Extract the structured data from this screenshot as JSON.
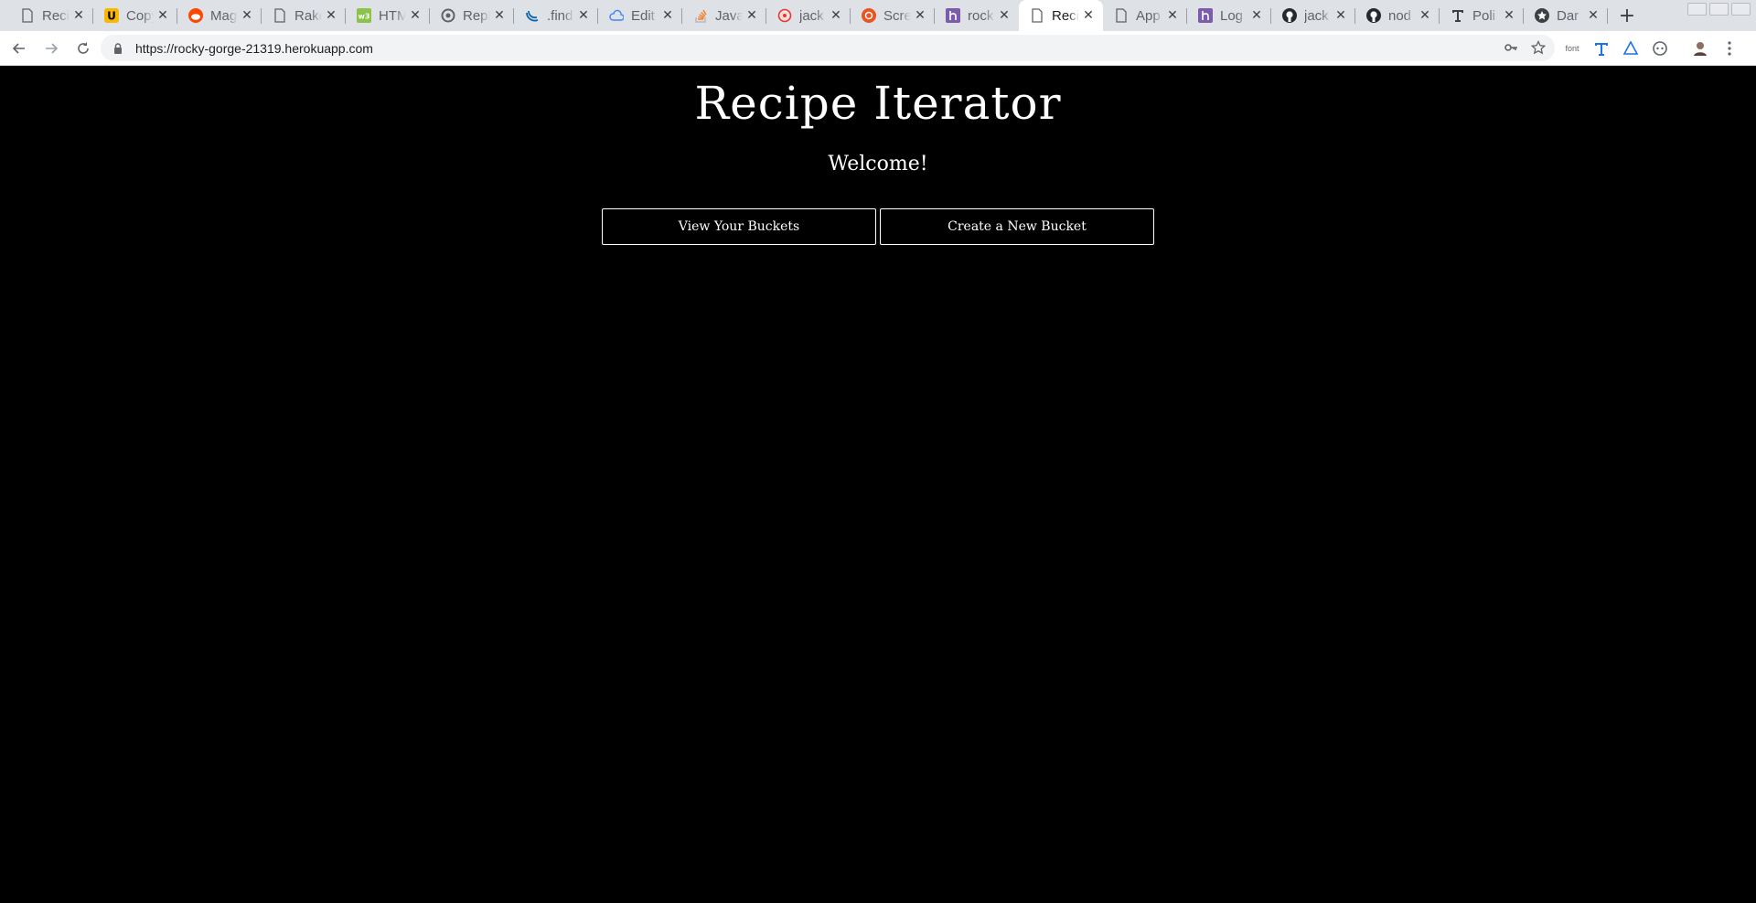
{
  "browser": {
    "tabs": [
      {
        "title": "Recipe Iterator",
        "icon": "page-icon"
      },
      {
        "title": "Copy",
        "icon": "u-favicon-icon"
      },
      {
        "title": "Magic",
        "icon": "reddit-icon"
      },
      {
        "title": "Rake",
        "icon": "page-icon"
      },
      {
        "title": "HTML",
        "icon": "html-favicon-icon"
      },
      {
        "title": "Reply",
        "icon": "circle-favicon-icon"
      },
      {
        "title": ".find",
        "icon": "jquery-icon"
      },
      {
        "title": "Edit",
        "icon": "cloud-icon"
      },
      {
        "title": "Java",
        "icon": "stackoverflow-icon"
      },
      {
        "title": "jack",
        "icon": "red-favicon-icon"
      },
      {
        "title": "Scre",
        "icon": "ubuntu-icon"
      },
      {
        "title": "rock",
        "icon": "heroku-icon"
      },
      {
        "title": "Reci",
        "icon": "page-icon",
        "active": true
      },
      {
        "title": "App",
        "icon": "page-icon"
      },
      {
        "title": "Log",
        "icon": "heroku-icon"
      },
      {
        "title": "jack",
        "icon": "github-icon"
      },
      {
        "title": "nod",
        "icon": "github-icon"
      },
      {
        "title": "Poli",
        "icon": "typeface-icon"
      },
      {
        "title": "Dar",
        "icon": "star-circle-icon"
      }
    ],
    "url": "https://rocky-gorge-21319.herokuapp.com",
    "font_ext_label": "font"
  },
  "page": {
    "title": "Recipe Iterator",
    "welcome": "Welcome!",
    "view_buckets_label": "View Your Buckets",
    "create_bucket_label": "Create a New Bucket"
  },
  "colors": {
    "page_background": "#000000",
    "tabstrip": "#dee1e6",
    "heroku_purple": "#7b5cab",
    "reddit": "#ff4500",
    "ubuntu": "#e95420"
  }
}
